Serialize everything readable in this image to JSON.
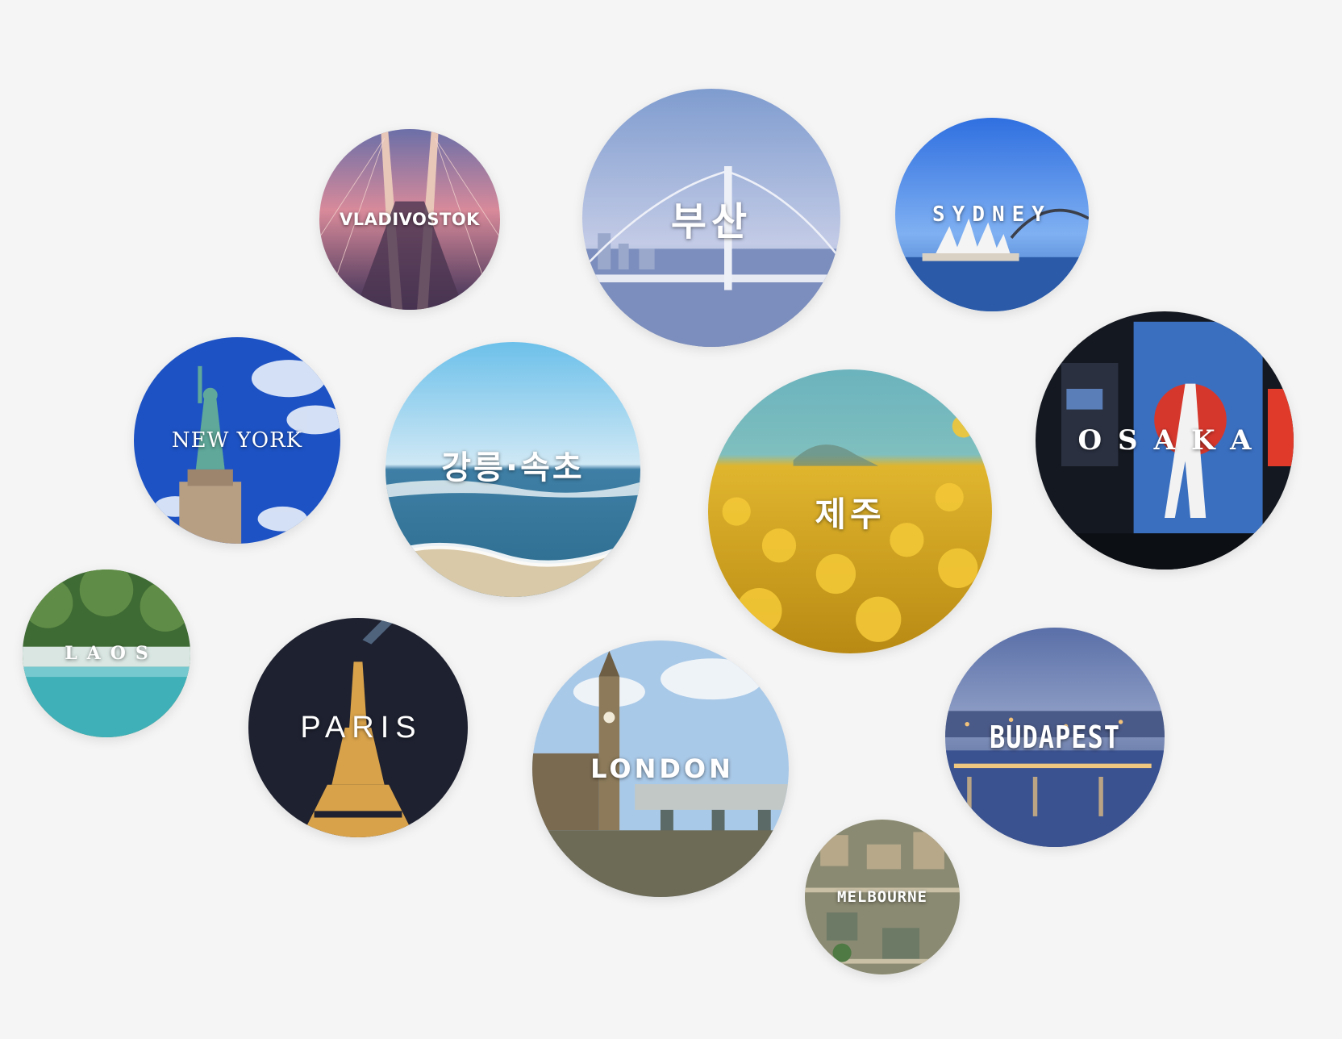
{
  "destinations": [
    {
      "id": "vladivostok",
      "label": "VLADIVOSTOK"
    },
    {
      "id": "busan",
      "label": "부산"
    },
    {
      "id": "sydney",
      "label": "SYDNEY"
    },
    {
      "id": "newyork",
      "label": "NEW YORK"
    },
    {
      "id": "gangneung",
      "label": "강릉·속초"
    },
    {
      "id": "jeju",
      "label": "제주"
    },
    {
      "id": "osaka",
      "label": "OSAKA"
    },
    {
      "id": "laos",
      "label": "LAOS"
    },
    {
      "id": "paris",
      "label": "PARIS"
    },
    {
      "id": "london",
      "label": "LONDON"
    },
    {
      "id": "budapest",
      "label": "BUDAPEST"
    },
    {
      "id": "melbourne",
      "label": "MELBOURNE"
    }
  ],
  "colors": {
    "background": "#f5f5f5",
    "label": "#ffffff"
  }
}
